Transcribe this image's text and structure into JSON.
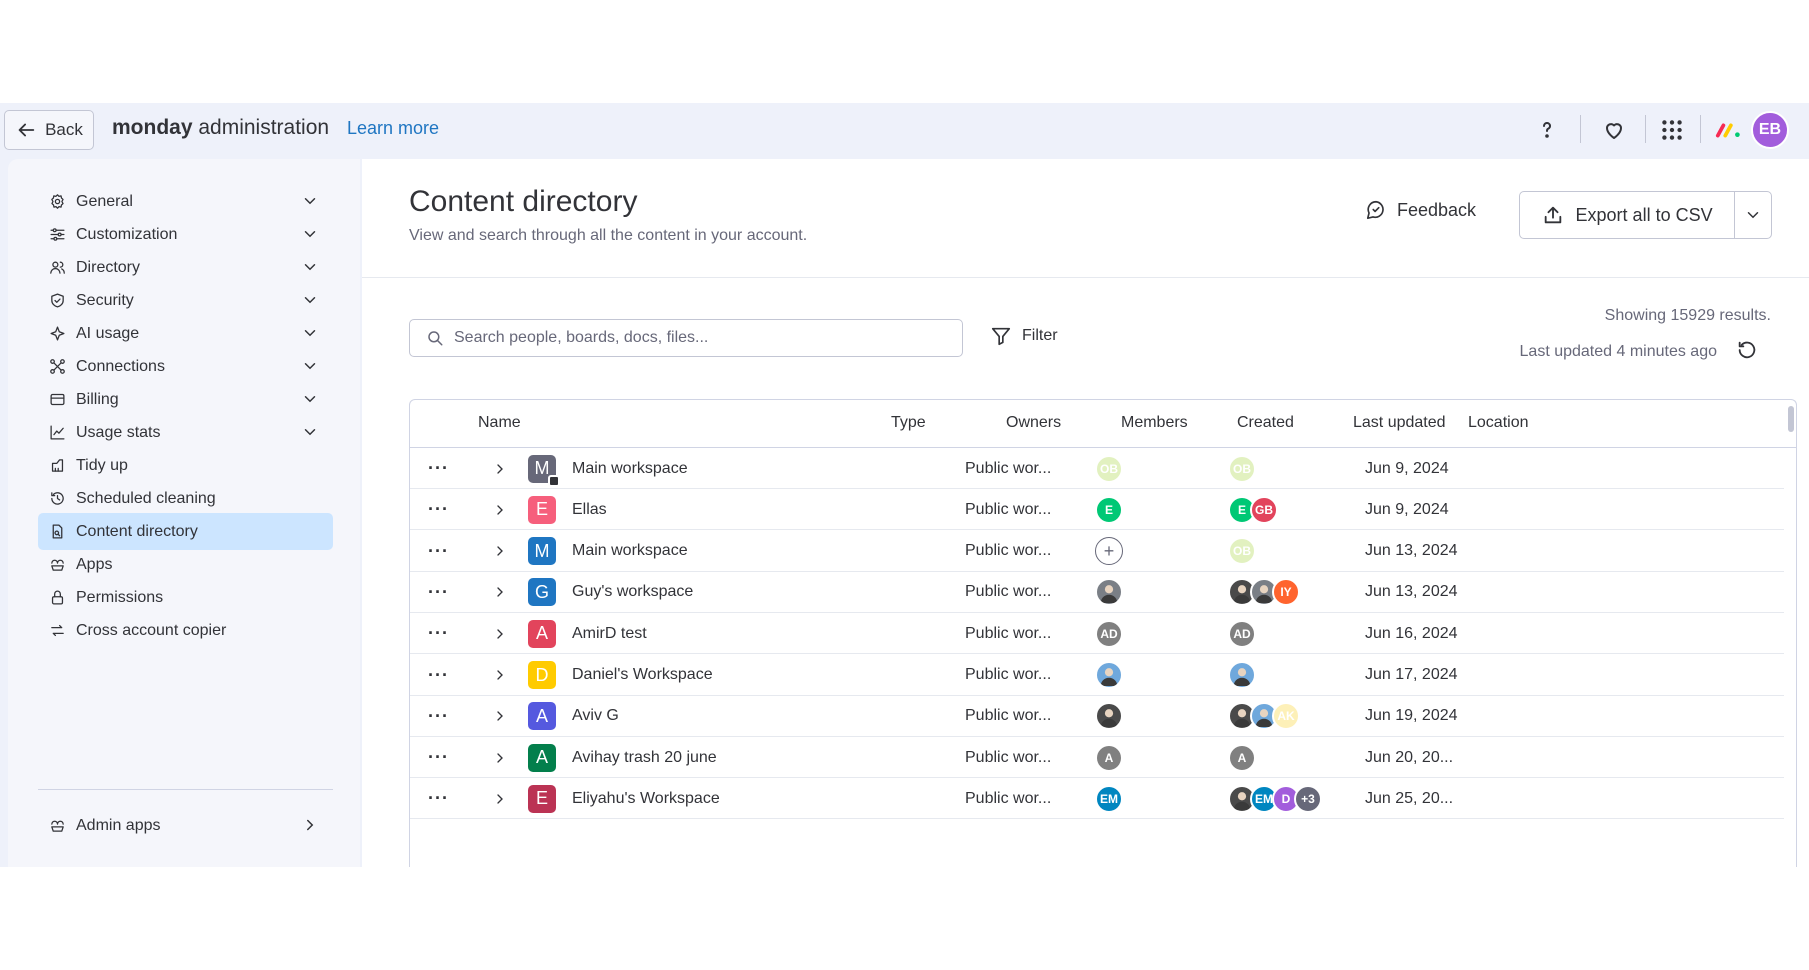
{
  "topbar": {
    "back_label": "Back",
    "brand_bold": "monday",
    "brand_rest": " administration",
    "learn_more": "Learn more",
    "avatar_initials": "EB",
    "avatar_color": "#a25ddc"
  },
  "sidebar": {
    "items": [
      {
        "label": "General",
        "icon": "gear-icon",
        "chevron": "down"
      },
      {
        "label": "Customization",
        "icon": "sliders-icon",
        "chevron": "down"
      },
      {
        "label": "Directory",
        "icon": "people-icon",
        "chevron": "down"
      },
      {
        "label": "Security",
        "icon": "shield-icon",
        "chevron": "down"
      },
      {
        "label": "AI usage",
        "icon": "ai-sparkle-icon",
        "chevron": "down"
      },
      {
        "label": "Connections",
        "icon": "connections-icon",
        "chevron": "down"
      },
      {
        "label": "Billing",
        "icon": "card-icon",
        "chevron": "down"
      },
      {
        "label": "Usage stats",
        "icon": "chart-icon",
        "chevron": "down"
      },
      {
        "label": "Tidy up",
        "icon": "broom-icon",
        "chevron": ""
      },
      {
        "label": "Scheduled cleaning",
        "icon": "history-icon",
        "chevron": ""
      },
      {
        "label": "Content directory",
        "icon": "document-search-icon",
        "chevron": "",
        "active": true
      },
      {
        "label": "Apps",
        "icon": "apps-icon",
        "chevron": ""
      },
      {
        "label": "Permissions",
        "icon": "lock-icon",
        "chevron": ""
      },
      {
        "label": "Cross account copier",
        "icon": "arrows-icon",
        "chevron": ""
      }
    ],
    "admin_apps": {
      "label": "Admin apps",
      "icon": "apps-icon",
      "chevron": "right"
    }
  },
  "main": {
    "title": "Content directory",
    "subtitle": "View and search through all the content in your account.",
    "feedback_label": "Feedback",
    "export_label": "Export all to CSV",
    "search_placeholder": "Search people, boards, docs, files...",
    "filter_label": "Filter",
    "showing": "Showing 15929 results.",
    "last_updated": "Last updated 4 minutes ago"
  },
  "table": {
    "columns": [
      "Name",
      "Type",
      "Owners",
      "Members",
      "Created",
      "Last updated",
      "Location"
    ],
    "rows": [
      {
        "letter": "M",
        "color": "#676879",
        "home": true,
        "name": "Main workspace",
        "type": "Public wor...",
        "owners": [
          {
            "t": "OB",
            "c": "#e2f1c0",
            "k": "light"
          }
        ],
        "members": [
          {
            "t": "OB",
            "c": "#e2f1c0",
            "k": "light"
          }
        ],
        "created": "Jun 9, 2024"
      },
      {
        "letter": "E",
        "color": "#f65f7c",
        "home": false,
        "name": "Ellas",
        "type": "Public wor...",
        "owners": [
          {
            "t": "E",
            "c": "#00c875"
          }
        ],
        "members": [
          {
            "t": "E",
            "c": "#00c875"
          },
          {
            "t": "GB",
            "c": "#e2445c"
          }
        ],
        "created": "Jun 9, 2024"
      },
      {
        "letter": "M",
        "color": "#1f76c2",
        "home": false,
        "name": "Main workspace",
        "type": "Public wor...",
        "owners": [
          {
            "t": "+",
            "k": "outline"
          }
        ],
        "members": [
          {
            "t": "OB",
            "c": "#e2f1c0",
            "k": "light"
          }
        ],
        "created": "Jun 13, 2024"
      },
      {
        "letter": "G",
        "color": "#1f76c2",
        "home": false,
        "name": "Guy's workspace",
        "type": "Public wor...",
        "owners": [
          {
            "t": "",
            "k": "photo"
          }
        ],
        "members": [
          {
            "t": "",
            "k": "photo3"
          },
          {
            "t": "",
            "k": "photo"
          },
          {
            "t": "IY",
            "c": "#ff642e"
          }
        ],
        "created": "Jun 13, 2024"
      },
      {
        "letter": "A",
        "color": "#e2445c",
        "home": false,
        "name": "AmirD test",
        "type": "Public wor...",
        "owners": [
          {
            "t": "AD",
            "c": "#808080"
          }
        ],
        "members": [
          {
            "t": "AD",
            "c": "#808080"
          }
        ],
        "created": "Jun 16, 2024"
      },
      {
        "letter": "D",
        "color": "#ffcb00",
        "home": false,
        "name": "Daniel's Workspace",
        "type": "Public wor...",
        "owners": [
          {
            "t": "",
            "k": "photo2"
          }
        ],
        "members": [
          {
            "t": "",
            "k": "photo2"
          }
        ],
        "created": "Jun 17, 2024"
      },
      {
        "letter": "A",
        "color": "#5559df",
        "home": false,
        "name": "Aviv G",
        "type": "Public wor...",
        "owners": [
          {
            "t": "",
            "k": "photo3"
          }
        ],
        "members": [
          {
            "t": "",
            "k": "photo3"
          },
          {
            "t": "",
            "k": "photo2"
          },
          {
            "t": "AK",
            "c": "#fdf0b8",
            "k": "light"
          }
        ],
        "created": "Jun 19, 2024"
      },
      {
        "letter": "A",
        "color": "#037f4c",
        "home": false,
        "name": "Avihay trash 20 june",
        "type": "Public wor...",
        "owners": [
          {
            "t": "A",
            "c": "#808080"
          }
        ],
        "members": [
          {
            "t": "A",
            "c": "#808080"
          }
        ],
        "created": "Jun 20, 20..."
      },
      {
        "letter": "E",
        "color": "#bb3354",
        "home": false,
        "name": "Eliyahu's Workspace",
        "type": "Public wor...",
        "owners": [
          {
            "t": "EM",
            "c": "#0086c0"
          }
        ],
        "members": [
          {
            "t": "",
            "k": "photo3"
          },
          {
            "t": "EM",
            "c": "#0086c0"
          },
          {
            "t": "D",
            "c": "#a25ddc"
          },
          {
            "t": "+3",
            "c": "#676879"
          }
        ],
        "created": "Jun 25, 20..."
      }
    ]
  }
}
